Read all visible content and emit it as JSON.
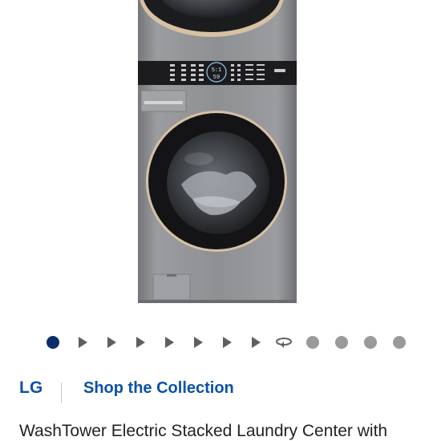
{
  "product": {
    "title": "WashTower Electric Stacked Laundry Center with"
  },
  "brand": {
    "name": "LG",
    "collection_link": "Shop the Collection"
  },
  "dryer_display": {
    "top_readout": "5:1",
    "bottom_readout": "59"
  },
  "carousel": {
    "items": [
      {
        "kind": "image-dot",
        "active": true
      },
      {
        "kind": "video"
      },
      {
        "kind": "video"
      },
      {
        "kind": "video"
      },
      {
        "kind": "video"
      },
      {
        "kind": "video"
      },
      {
        "kind": "video"
      },
      {
        "kind": "video"
      },
      {
        "kind": "360-view"
      },
      {
        "kind": "image-dot",
        "active": false
      },
      {
        "kind": "image-dot",
        "active": false
      },
      {
        "kind": "image-dot",
        "active": false
      },
      {
        "kind": "image-dot",
        "active": false
      }
    ]
  },
  "colors": {
    "link_blue": "#0a51a8",
    "active_dot": "#0b2d6b",
    "inactive_dot": "#9a9a9a",
    "appliance_body": "#8c8e91",
    "control_panel": "#1c1c1e",
    "door_ring": "#d7c1a4"
  }
}
